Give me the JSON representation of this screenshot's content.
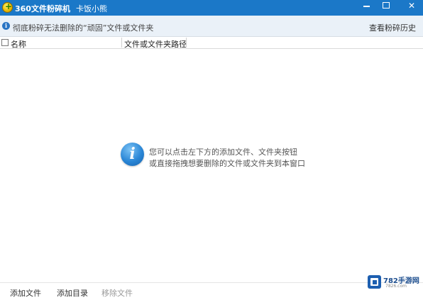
{
  "window": {
    "title": "360文件粉碎机",
    "subtitle": "卡饭小熊"
  },
  "infobar": {
    "message": "彻底粉碎无法删除的“顽固”文件或文件夹",
    "history_link": "查看粉碎历史"
  },
  "columns": {
    "name": "名称",
    "path": "文件或文件夹路径"
  },
  "empty_hint": {
    "line1": "您可以点击左下方的添加文件、文件夹按钮",
    "line2": "或直接拖拽想要删除的文件或文件夹到本窗口"
  },
  "watermark": {
    "title": "782手游网",
    "url": "7826.com"
  },
  "footer": {
    "add_file": "添加文件",
    "add_dir": "添加目录",
    "remove_file": "移除文件"
  },
  "icons": {
    "app": "app-logo-icon",
    "info": "info-icon",
    "hint": "info-large-icon"
  },
  "colors": {
    "titlebar": "#1b78c8",
    "infobar": "#eaf1f8",
    "hint_icon": "#2a86d6"
  }
}
